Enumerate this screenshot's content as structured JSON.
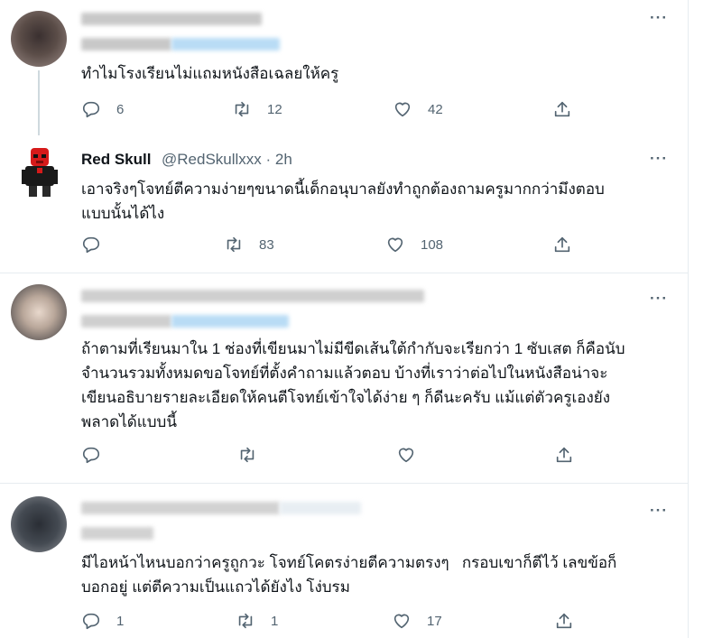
{
  "colors": {
    "text": "#0f1419",
    "secondary": "#536471",
    "divider": "#e6ecf0"
  },
  "tweets": [
    {
      "author": "",
      "handle": "",
      "time": "",
      "text": "ทำไมโรงเรียนไม่แถมหนังสือเฉลยให้ครู",
      "replies": "6",
      "retweets": "12",
      "likes": "42"
    },
    {
      "author": "Red Skull",
      "handle": "@RedSkullxxx · 2h",
      "text": "เอาจริงๆโจทย์ตีความง่ายๆขนาดนี้เด็กอนุบาลยังทำถูกต้องถามครูมากกว่ามึงตอบ\nแบบนั้นได้ไง",
      "replies": "",
      "retweets": "83",
      "likes": "108"
    },
    {
      "author": "",
      "handle": "",
      "text": "ถ้าตามที่เรียนมาใน 1 ช่องที่เขียนมาไม่มีขีดเส้นใต้กำกับจะเรียกว่า 1 ซับเสต ก็คือนับ\nจำนวนรวมทั้งหมดขอโจทย์ที่ตั้งคำถามแล้วตอบ บ้างที่เราว่าต่อไปในหนังสือน่าจะ\nเขียนอธิบายรายละเอียดให้คนตีโจทย์เข้าใจได้ง่าย ๆ ก็ดีนะครับ แม้แต่ตัวครูเองยัง\nพลาดได้แบบนี้",
      "replies": "",
      "retweets": "",
      "likes": ""
    },
    {
      "author": "",
      "handle": "",
      "text": "มีไอหน้าไหนบอกว่าครูถูกวะ โจทย์โคตรง่ายตีความตรงๆ   กรอบเขาก็ตีไว้ เลขข้อก็\nบอกอยู่ แต่ตีความเป็นแถวได้ยังไง โง่บรม",
      "replies": "1",
      "retweets": "1",
      "likes": "17"
    }
  ],
  "icons": [
    "reply-icon",
    "retweet-icon",
    "like-icon",
    "share-icon",
    "more-icon"
  ]
}
